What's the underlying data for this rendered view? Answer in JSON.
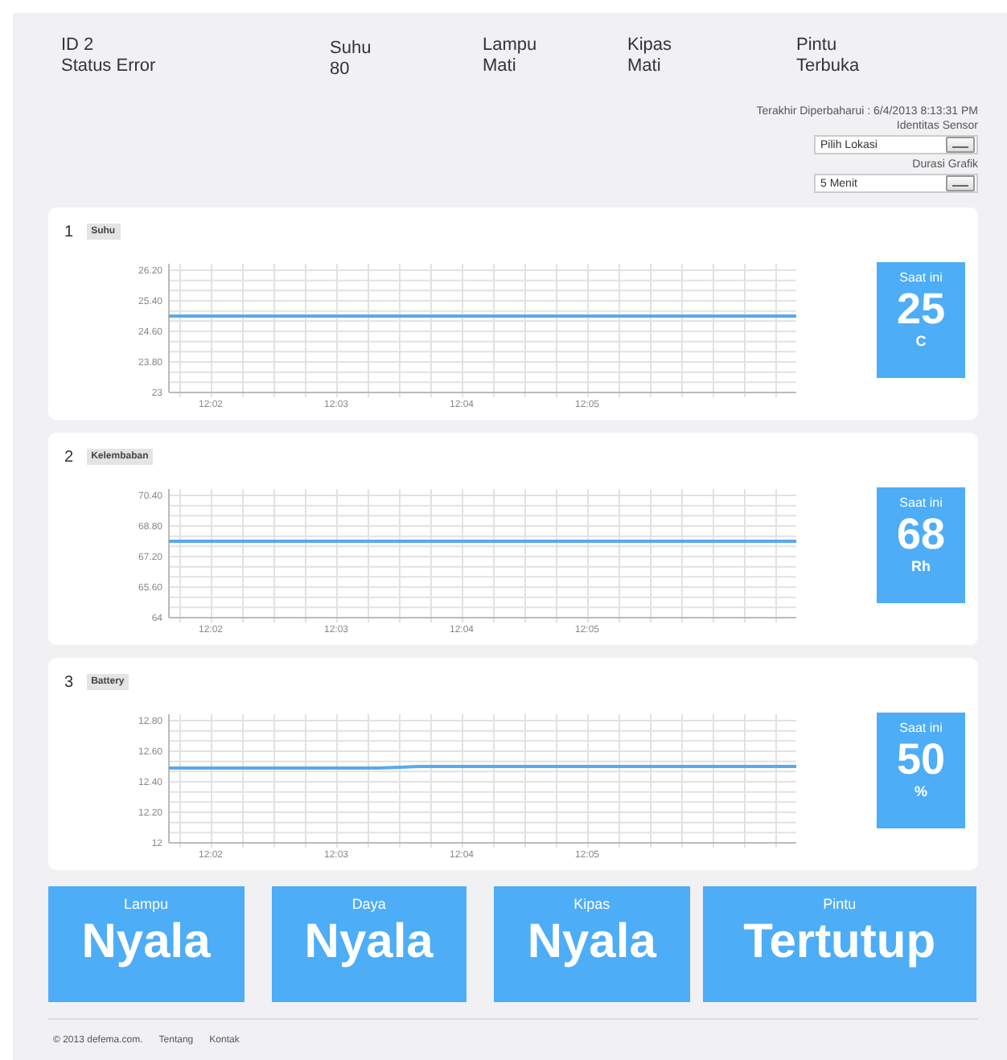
{
  "header": {
    "device": {
      "id": "ID 2",
      "status": "Status Error"
    },
    "readings": [
      {
        "label": "Suhu",
        "value": "80"
      },
      {
        "label": "Lampu",
        "value": "Mati"
      },
      {
        "label": "Kipas",
        "value": "Mati"
      },
      {
        "label": "Pintu",
        "value": "Terbuka"
      }
    ],
    "last_updated": "Terakhir Diperbaharui : 6/4/2013 8:13:31 PM",
    "sensor_label": "Identitas Sensor",
    "sensor_select": {
      "value": "Pilih Lokasi"
    },
    "duration_label": "Durasi Grafik",
    "duration_select": {
      "value": "5 Menit"
    }
  },
  "sensors": [
    {
      "number": "1",
      "name": "Suhu",
      "current_label": "Saat ini",
      "current_value": "25",
      "unit": "C",
      "chart_data": {
        "type": "line",
        "grid": true,
        "categories": [
          null,
          "12:02",
          null,
          null,
          "12:03",
          null,
          null,
          "12:04",
          null,
          null,
          "12:05",
          null,
          null,
          null,
          null,
          null
        ],
        "series": [
          {
            "color": "#5aa9ec",
            "values": [
              25,
              25,
              25,
              25,
              25,
              25,
              25,
              25,
              25,
              25,
              25,
              25,
              25,
              25,
              25,
              25
            ]
          }
        ],
        "ylim": [
          23,
          26.2
        ],
        "yticks": [
          {
            "value": 23,
            "label": "23"
          },
          {
            "value": 23.8,
            "label": "23.80"
          },
          {
            "value": 24.6,
            "label": "24.60"
          },
          {
            "value": 25.4,
            "label": "25.40"
          },
          {
            "value": 26.2,
            "label": "26.20"
          }
        ]
      }
    },
    {
      "number": "2",
      "name": "Kelembaban",
      "current_label": "Saat ini",
      "current_value": "68",
      "unit": "Rh",
      "chart_data": {
        "type": "line",
        "grid": true,
        "categories": [
          null,
          "12:02",
          null,
          null,
          "12:03",
          null,
          null,
          "12:04",
          null,
          null,
          "12:05",
          null,
          null,
          null,
          null,
          null
        ],
        "series": [
          {
            "color": "#5aa9ec",
            "values": [
              68,
              68,
              68,
              68,
              68,
              68,
              68,
              68,
              68,
              68,
              68,
              68,
              68,
              68,
              68,
              68
            ]
          }
        ],
        "ylim": [
          64,
          70.4
        ],
        "yticks": [
          {
            "value": 64,
            "label": "64"
          },
          {
            "value": 65.6,
            "label": "65.60"
          },
          {
            "value": 67.2,
            "label": "67.20"
          },
          {
            "value": 68.8,
            "label": "68.80"
          },
          {
            "value": 70.4,
            "label": "70.40"
          }
        ]
      }
    },
    {
      "number": "3",
      "name": "Battery",
      "current_label": "Saat ini",
      "current_value": "50",
      "unit": "%",
      "chart_data": {
        "type": "line",
        "grid": true,
        "categories": [
          null,
          "12:02",
          null,
          null,
          "12:03",
          null,
          null,
          "12:04",
          null,
          null,
          "12:05",
          null,
          null,
          null,
          null,
          null
        ],
        "series": [
          {
            "color": "#5aa9ec",
            "values": [
              12.49,
              12.49,
              12.49,
              12.49,
              12.49,
              12.49,
              12.5,
              12.5,
              12.5,
              12.5,
              12.5,
              12.5,
              12.5,
              12.5,
              12.5,
              12.5
            ]
          }
        ],
        "ylim": [
          12,
          12.8
        ],
        "yticks": [
          {
            "value": 12,
            "label": "12"
          },
          {
            "value": 12.2,
            "label": "12.20"
          },
          {
            "value": 12.4,
            "label": "12.40"
          },
          {
            "value": 12.6,
            "label": "12.60"
          },
          {
            "value": 12.8,
            "label": "12.80"
          }
        ]
      }
    }
  ],
  "controls": [
    {
      "label": "Lampu",
      "state": "Nyala"
    },
    {
      "label": "Daya",
      "state": "Nyala"
    },
    {
      "label": "Kipas",
      "state": "Nyala"
    },
    {
      "label": "Pintu",
      "state": "Tertutup"
    }
  ],
  "footer": {
    "copyright": "© 2013 defema.com.",
    "links": [
      "Tentang",
      "Kontak"
    ]
  }
}
